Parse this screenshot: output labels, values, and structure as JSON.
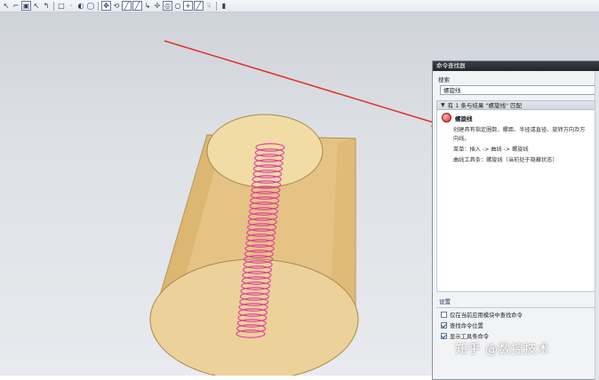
{
  "toolbar": {
    "buttons": [
      {
        "name": "arrow-icon",
        "glyph": "↖"
      },
      {
        "name": "snap-icon",
        "glyph": "⌐"
      },
      {
        "name": "select-box-icon",
        "glyph": "▣",
        "boxed": true
      },
      {
        "name": "lasso-icon",
        "glyph": "↖"
      },
      {
        "name": "curve-select-icon",
        "glyph": "↰"
      },
      {
        "name": "sep",
        "glyph": ""
      },
      {
        "name": "rectangle-icon",
        "glyph": "□"
      },
      {
        "name": "dropdown-icon",
        "glyph": "·"
      },
      {
        "name": "shade-icon",
        "glyph": "◐"
      },
      {
        "name": "wireframe-icon",
        "glyph": "◯"
      },
      {
        "name": "sep",
        "glyph": ""
      },
      {
        "name": "move-icon",
        "glyph": "✥",
        "boxed": true
      },
      {
        "name": "rotate-icon",
        "glyph": "⟲"
      },
      {
        "name": "line-icon",
        "glyph": "╱",
        "boxed": true
      },
      {
        "name": "diagonal-icon",
        "glyph": "╱",
        "boxed": true
      },
      {
        "name": "bend-icon",
        "glyph": "↳"
      },
      {
        "name": "point-icon",
        "glyph": "✢"
      },
      {
        "name": "circle-target-icon",
        "glyph": "◎",
        "boxed": true
      },
      {
        "name": "circle-icon",
        "glyph": "○"
      },
      {
        "name": "plus-icon",
        "glyph": "+",
        "boxed": true
      },
      {
        "name": "slash-icon",
        "glyph": "╱",
        "boxed": true
      },
      {
        "name": "pointer-icon",
        "glyph": "☟"
      },
      {
        "name": "sep",
        "glyph": ""
      },
      {
        "name": "layer-icon",
        "glyph": "▮"
      }
    ]
  },
  "dialog": {
    "title": "命令查找器",
    "search_label": "搜索",
    "search_value": "螺旋线",
    "results_header": "有 1 条与结果 \"螺旋线\" 匹配",
    "result": {
      "name": "螺旋线",
      "lines": [
        "创建具有指定圈数、螺距、半径或直径、旋转方向及方",
        "向线。",
        "菜单：插入 -> 曲线 -> 螺旋线",
        "曲线工具条：螺旋线（当前处于隐藏状态）"
      ]
    },
    "settings_label": "设置",
    "options": [
      {
        "label": "仅在当前应用模块中查找命令",
        "checked": false
      },
      {
        "label": "查找命令位置",
        "checked": true
      },
      {
        "label": "显示工具条命令",
        "checked": true
      }
    ]
  },
  "watermark": "知乎 @数控技术",
  "colors": {
    "cone_fill": "#e9c98c",
    "helix": "#e0379f",
    "arrow": "#e0302a"
  }
}
